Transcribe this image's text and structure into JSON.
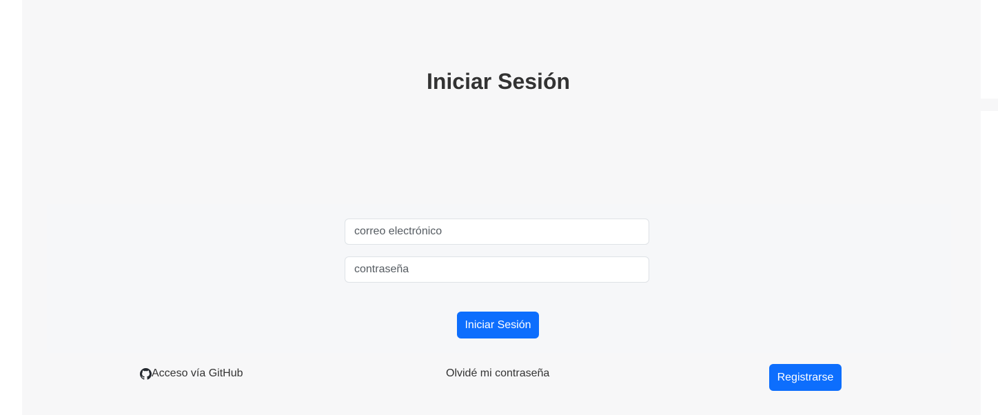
{
  "login": {
    "title": "Iniciar Sesión",
    "email_placeholder": "correo electrónico",
    "password_placeholder": "contraseña",
    "submit_label": "Iniciar Sesión"
  },
  "footer": {
    "github_label": "Acceso vía GitHub",
    "github_icon": "github-icon",
    "forgot_label": "Olvidé mi contraseña",
    "register_label": "Registrarse"
  },
  "colors": {
    "accent": "#0d6efd",
    "background": "#f7f7f8",
    "text": "#333333"
  }
}
